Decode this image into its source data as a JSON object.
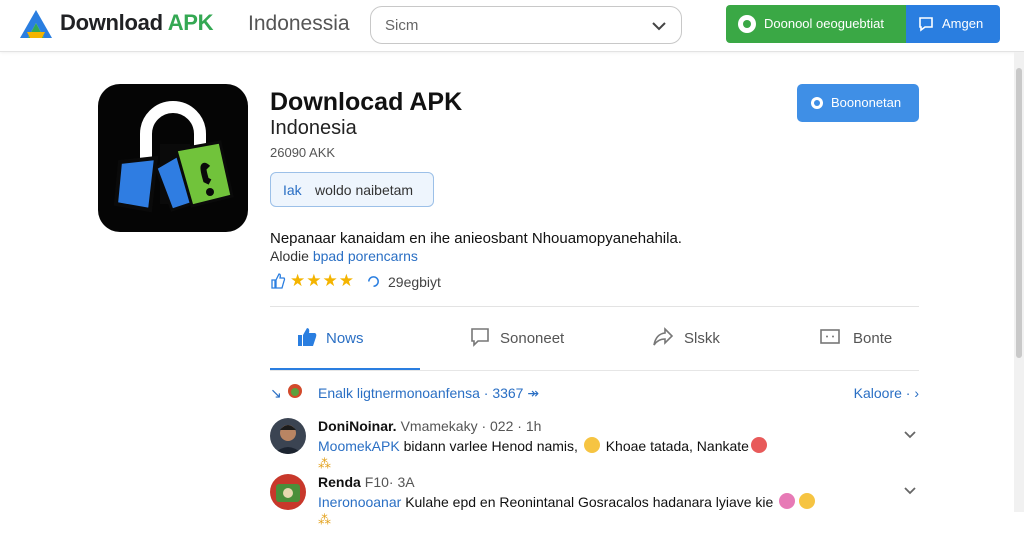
{
  "header": {
    "brand_main": "Download",
    "brand_apk": "APK",
    "region": "Indonessia",
    "search_value": "Sicm",
    "download_button": "Doonool oeoguebtiat",
    "second_button": "Amgen"
  },
  "app": {
    "title": "Downlocad APK",
    "subtitle": "Indonesia",
    "meta": "26090 AKK",
    "tag_key": "Iak",
    "tag_value": "woldo naibetam",
    "action_button": "Boononetan",
    "description": "Nepanaar kanaidam en ihe anieosbant Nhouamopyanehahila.",
    "desc_line2_a": "Alodie",
    "desc_line2_b": "bpad porencarns",
    "stars": "★★★★",
    "rating_count": "29egbiyt"
  },
  "tabs": [
    {
      "label": "Nows",
      "icon": "thumbs-up-icon",
      "active": true
    },
    {
      "label": "Sononeet",
      "icon": "comment-icon",
      "active": false
    },
    {
      "label": "Slskk",
      "icon": "share-icon",
      "active": false
    },
    {
      "label": "Bonte",
      "icon": "screen-icon",
      "active": false
    }
  ],
  "feed": {
    "prefix": "↘",
    "filter_text": "Enalk ligtnermonoanfensa · 3367 ↠",
    "right_link": "Kaloore · ›",
    "posts": [
      {
        "name": "DoniNoinar.",
        "time": "Vmamekaky · 022 · 1h",
        "handle": "MoomekAPK",
        "text": "bidann varlee Henod namis,",
        "text2": "Khoae tatada, Nankate",
        "sub": "⁂"
      },
      {
        "name": "Renda",
        "time": "F10· 3A",
        "handle": "Ineronooanar",
        "text": "Kulahe epd en Reonintanal Gosracalos hadanara lyiave kie",
        "text2": "",
        "sub": "⁂"
      }
    ]
  },
  "colors": {
    "brand_green": "#34a853",
    "accent_blue": "#2a7ee0",
    "button_green": "#3aa845",
    "star": "#f4b400"
  }
}
